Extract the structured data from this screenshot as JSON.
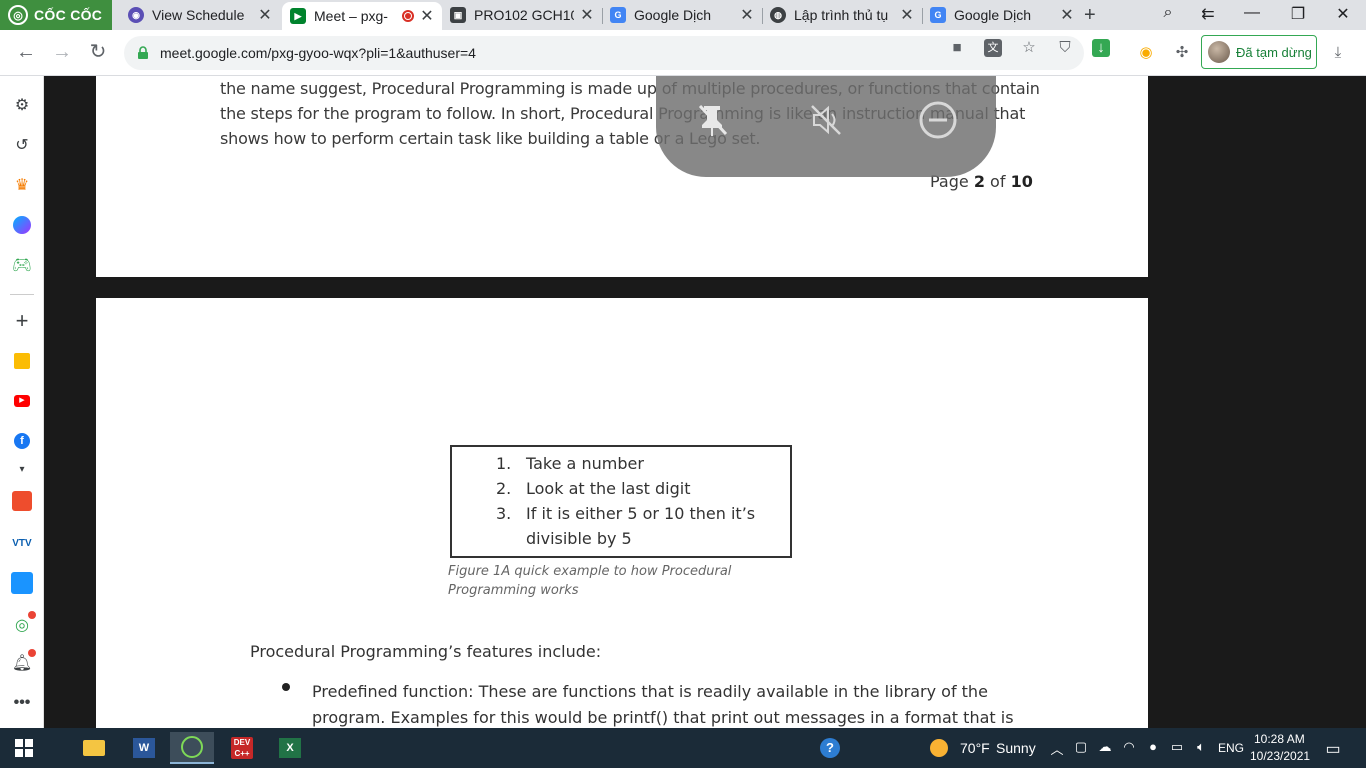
{
  "browser": {
    "brand_name": "CỐC CỐC",
    "tabs": [
      {
        "label": "View Schedule",
        "active": false
      },
      {
        "label": "Meet – pxg-",
        "active": true,
        "recording": true
      },
      {
        "label": "PRO102 GCH10",
        "active": false
      },
      {
        "label": "Google Dịch",
        "active": false
      },
      {
        "label": "Lập trình thủ tụ",
        "active": false
      },
      {
        "label": "Google Dịch",
        "active": false
      }
    ],
    "new_tab": "+",
    "address_url": "meet.google.com/pxg-gyoo-wqx?pli=1&authuser=4",
    "profile_label": "Đã tạm dừng"
  },
  "document": {
    "page1_lines": [
      "the name suggest, Procedural Programming is made up of multiple procedures, or functions that contain",
      "the steps for the program to follow. In short, Procedural Programming is like an instruction manual that",
      "shows how to perform certain task like building a table or a Lego set."
    ],
    "page_label_prefix": "Page ",
    "page_current": "2",
    "page_label_of": " of ",
    "page_total": "10",
    "figure_items": [
      {
        "num": "1.",
        "text": "Take a number"
      },
      {
        "num": "2.",
        "text": "Look at the last digit"
      },
      {
        "num": "3.",
        "text": "If it is either 5 or 10 then it’s"
      },
      {
        "num": "",
        "text": "divisible by 5"
      }
    ],
    "figure_caption_lines": [
      "Figure 1A quick example to how Procedural",
      "Programming works"
    ],
    "features_heading": "Procedural Programming’s features include:",
    "bullet_lines": [
      "Predefined function: These are functions that is readily available in the library of the",
      "program. Examples for this would be printf() that print out messages in a format that is"
    ]
  },
  "taskbar": {
    "weather_temp": "70°F",
    "weather_desc": "Sunny",
    "language": "ENG",
    "time": "10:28 AM",
    "date": "10/23/2021"
  },
  "colors": {
    "brand_green": "#3f8f3f",
    "taskbar_bg": "#1b2b38",
    "recording_red": "#d93025"
  }
}
